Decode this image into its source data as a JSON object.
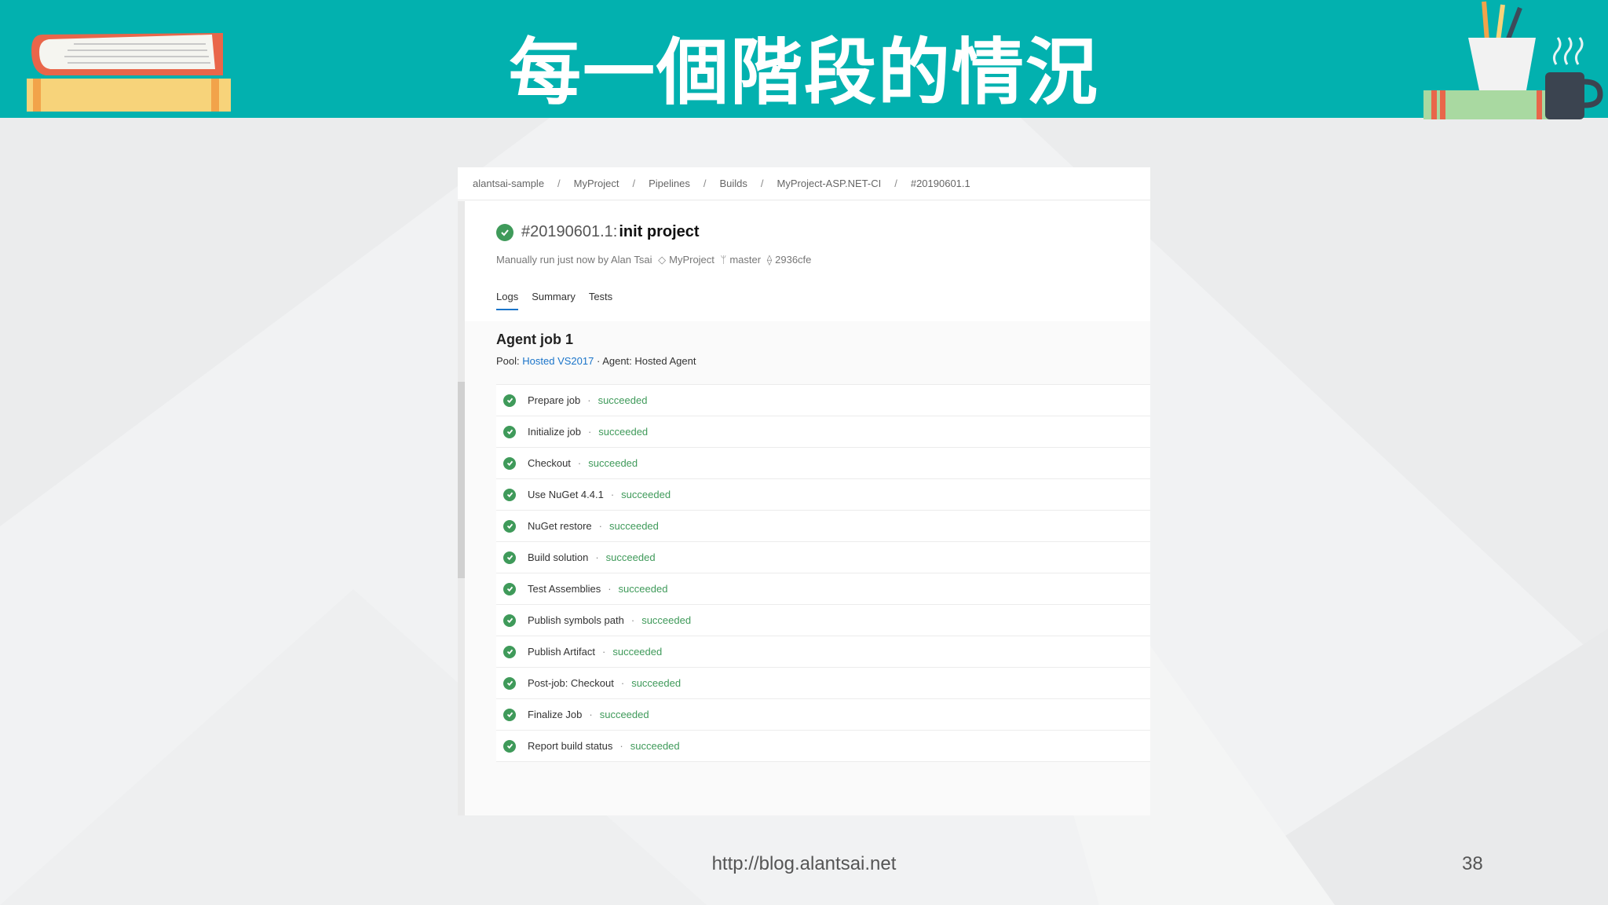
{
  "slide": {
    "title": "每一個階段的情況",
    "footer_url": "http://blog.alantsai.net",
    "page_number": "38"
  },
  "colors": {
    "header_bg": "#02b1af",
    "success": "#3f9a5a",
    "link": "#1a74c9"
  },
  "breadcrumb": [
    "alantsai-sample",
    "MyProject",
    "Pipelines",
    "Builds",
    "MyProject-ASP.NET-CI",
    "#20190601.1"
  ],
  "breadcrumb_separator": "/",
  "run": {
    "number": "#20190601.1:",
    "name": "init project",
    "status_icon": "check-circle-icon",
    "trigger": "Manually run just now by Alan Tsai",
    "repo": "MyProject",
    "branch": "master",
    "commit": "2936cfe"
  },
  "tabs": [
    {
      "label": "Logs",
      "active": true
    },
    {
      "label": "Summary",
      "active": false
    },
    {
      "label": "Tests",
      "active": false
    }
  ],
  "job": {
    "title": "Agent job 1",
    "pool_label": "Pool:",
    "pool_link": "Hosted VS2017",
    "agent_text": "· Agent: Hosted Agent"
  },
  "steps": [
    {
      "name": "Prepare job",
      "status": "succeeded"
    },
    {
      "name": "Initialize job",
      "status": "succeeded"
    },
    {
      "name": "Checkout",
      "status": "succeeded"
    },
    {
      "name": "Use NuGet 4.4.1",
      "status": "succeeded"
    },
    {
      "name": "NuGet restore",
      "status": "succeeded"
    },
    {
      "name": "Build solution",
      "status": "succeeded"
    },
    {
      "name": "Test Assemblies",
      "status": "succeeded"
    },
    {
      "name": "Publish symbols path",
      "status": "succeeded"
    },
    {
      "name": "Publish Artifact",
      "status": "succeeded"
    },
    {
      "name": "Post-job: Checkout",
      "status": "succeeded"
    },
    {
      "name": "Finalize Job",
      "status": "succeeded"
    },
    {
      "name": "Report build status",
      "status": "succeeded"
    }
  ]
}
